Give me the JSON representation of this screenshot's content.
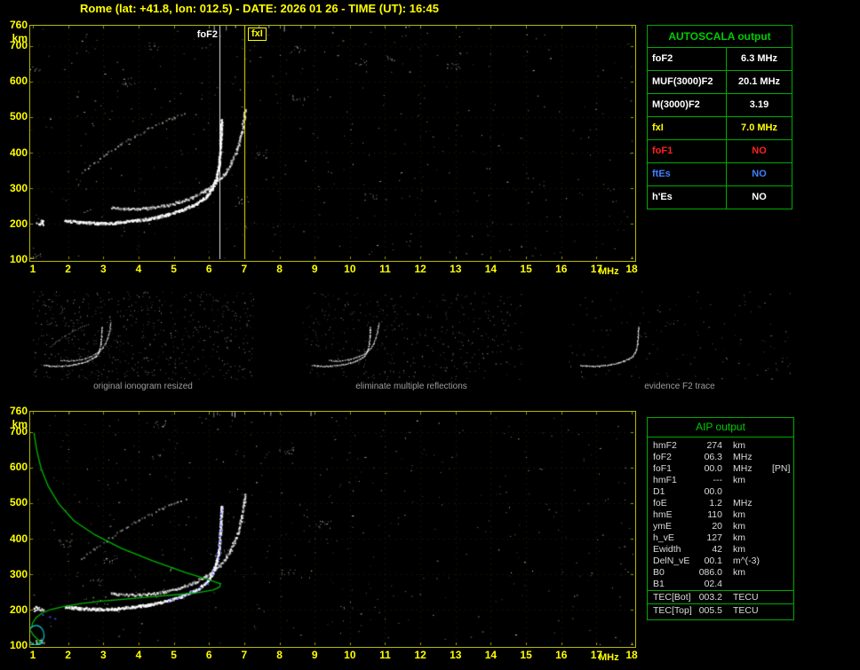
{
  "window": {
    "title": "Rome (lat: +41.8, lon: 012.5) - DATE: 2026 01 26 - TIME (UT): 16:45"
  },
  "colors": {
    "background": "#000000",
    "axis": "#ffff00",
    "plot_border": "#b8b800",
    "table_border": "#00aa00",
    "table_title": "#00cc00",
    "trace": "#ffffff",
    "multiple": "#9a9a9a",
    "profile": "#00b400",
    "restored_dots": "#4444ff",
    "ellipse": "#00cccc",
    "caption": "#9c9c9c",
    "fof2_marker": "#ffffff",
    "fxi_marker": "#ffff00"
  },
  "autoscala": {
    "title": "AUTOSCALA output",
    "rows": [
      {
        "label": "foF2",
        "value": "6.3 MHz",
        "color": "#ffffff"
      },
      {
        "label": "MUF(3000)F2",
        "value": "20.1 MHz",
        "color": "#ffffff"
      },
      {
        "label": "M(3000)F2",
        "value": "3.19",
        "color": "#ffffff"
      },
      {
        "label": "fxI",
        "value": "7.0 MHz",
        "color": "#ffff00"
      },
      {
        "label": "foF1",
        "value": "NO",
        "color": "#ff2020"
      },
      {
        "label": "ftEs",
        "value": "NO",
        "color": "#4080ff"
      },
      {
        "label": "h'Es",
        "value": "NO",
        "color": "#ffffff"
      }
    ]
  },
  "aip": {
    "title": "AIP output",
    "rows": [
      {
        "label": "hmF2",
        "value": "274",
        "unit": "km",
        "note": ""
      },
      {
        "label": "foF2",
        "value": "06.3",
        "unit": "MHz",
        "note": ""
      },
      {
        "label": "foF1",
        "value": "00.0",
        "unit": "MHz",
        "note": "[PN]"
      },
      {
        "label": "hmF1",
        "value": "---",
        "unit": "km",
        "note": ""
      },
      {
        "label": "D1",
        "value": "00.0",
        "unit": "",
        "note": ""
      },
      {
        "label": "foE",
        "value": "1.2",
        "unit": "MHz",
        "note": ""
      },
      {
        "label": "hmE",
        "value": "110",
        "unit": "km",
        "note": ""
      },
      {
        "label": "ymE",
        "value": "20",
        "unit": "km",
        "note": ""
      },
      {
        "label": "h_vE",
        "value": "127",
        "unit": "km",
        "note": ""
      },
      {
        "label": "Ewidth",
        "value": "42",
        "unit": "km",
        "note": ""
      },
      {
        "label": "DelN_vE",
        "value": "00.1",
        "unit": "m^(-3)",
        "note": ""
      },
      {
        "label": "B0",
        "value": "086.0",
        "unit": "km",
        "note": ""
      },
      {
        "label": "B1",
        "value": "02.4",
        "unit": "",
        "note": ""
      }
    ],
    "tec_rows": [
      {
        "label": "TEC[Bot]",
        "value": "003.2",
        "unit": "TECU"
      },
      {
        "label": "TEC[Top]",
        "value": "005.5",
        "unit": "TECU"
      }
    ]
  },
  "axes": {
    "y_top": "760",
    "y_unit": "km",
    "y_ticks": [
      "700",
      "600",
      "500",
      "400",
      "300",
      "200",
      "100"
    ],
    "x_ticks": [
      "1",
      "2",
      "3",
      "4",
      "5",
      "6",
      "7",
      "8",
      "9",
      "10",
      "11",
      "12",
      "13",
      "14",
      "15",
      "16",
      "17",
      "18"
    ],
    "x_unit": "MHz",
    "x_range_mhz": [
      1,
      18
    ],
    "y_range_km": [
      100,
      760
    ]
  },
  "markers": {
    "foF2": {
      "label": "foF2",
      "mhz": 6.3,
      "color": "#ffffff"
    },
    "fxI": {
      "label": "fxI",
      "mhz": 7.0,
      "color": "#ffff00"
    }
  },
  "thumbnails": [
    {
      "caption": "original ionogram resized"
    },
    {
      "caption": "eliminate multiple reflections"
    },
    {
      "caption": "evidence F2 trace"
    }
  ],
  "chart_data": {
    "type": "scatter",
    "note": "ionogram virtual height (km) vs frequency (MHz); approximate trace points read from screen",
    "f2_trace_o": [
      [
        1.9,
        210
      ],
      [
        2.3,
        205
      ],
      [
        2.8,
        203
      ],
      [
        3.3,
        204
      ],
      [
        3.8,
        209
      ],
      [
        4.3,
        216
      ],
      [
        4.8,
        227
      ],
      [
        5.2,
        240
      ],
      [
        5.6,
        257
      ],
      [
        5.9,
        278
      ],
      [
        6.05,
        300
      ],
      [
        6.18,
        330
      ],
      [
        6.26,
        372
      ],
      [
        6.3,
        425
      ],
      [
        6.32,
        470
      ],
      [
        6.33,
        495
      ]
    ],
    "f2_trace_x": [
      [
        3.2,
        247
      ],
      [
        3.7,
        243
      ],
      [
        4.2,
        245
      ],
      [
        4.7,
        252
      ],
      [
        5.1,
        262
      ],
      [
        5.5,
        276
      ],
      [
        5.85,
        294
      ],
      [
        6.15,
        315
      ],
      [
        6.4,
        340
      ],
      [
        6.6,
        372
      ],
      [
        6.78,
        415
      ],
      [
        6.9,
        460
      ],
      [
        6.97,
        505
      ],
      [
        7.0,
        525
      ]
    ],
    "multiple_reflection": [
      [
        2.35,
        345
      ],
      [
        2.7,
        372
      ],
      [
        3.05,
        398
      ],
      [
        3.45,
        424
      ],
      [
        3.85,
        448
      ],
      [
        4.25,
        470
      ],
      [
        4.65,
        489
      ],
      [
        5.0,
        504
      ],
      [
        5.3,
        515
      ]
    ],
    "profile_topside": [
      [
        1.02,
        700
      ],
      [
        1.1,
        650
      ],
      [
        1.22,
        600
      ],
      [
        1.42,
        550
      ],
      [
        1.72,
        500
      ],
      [
        2.15,
        452
      ],
      [
        2.75,
        412
      ],
      [
        3.5,
        374
      ],
      [
        4.4,
        338
      ],
      [
        5.3,
        306
      ],
      [
        5.95,
        286
      ],
      [
        6.28,
        275
      ],
      [
        6.32,
        274
      ]
    ],
    "profile_bottomside": [
      [
        6.32,
        274
      ],
      [
        6.28,
        264
      ],
      [
        6.1,
        256
      ],
      [
        5.7,
        249
      ],
      [
        5.1,
        243
      ],
      [
        4.4,
        237
      ],
      [
        3.7,
        231
      ],
      [
        3.0,
        225
      ],
      [
        2.4,
        218
      ],
      [
        1.9,
        210
      ],
      [
        1.5,
        201
      ],
      [
        1.25,
        191
      ],
      [
        1.08,
        178
      ],
      [
        0.98,
        163
      ],
      [
        0.95,
        150
      ]
    ],
    "profile_e_region": [
      [
        0.92,
        142
      ],
      [
        1.0,
        128
      ],
      [
        1.12,
        117
      ],
      [
        1.2,
        110
      ],
      [
        1.12,
        101
      ],
      [
        1.0,
        95
      ],
      [
        0.92,
        91
      ]
    ],
    "restored_extra_points": [
      [
        1.25,
        188
      ],
      [
        1.45,
        182
      ],
      [
        1.6,
        177
      ]
    ],
    "e_valley_ellipse": {
      "mhz": 1.08,
      "km": 128
    }
  }
}
